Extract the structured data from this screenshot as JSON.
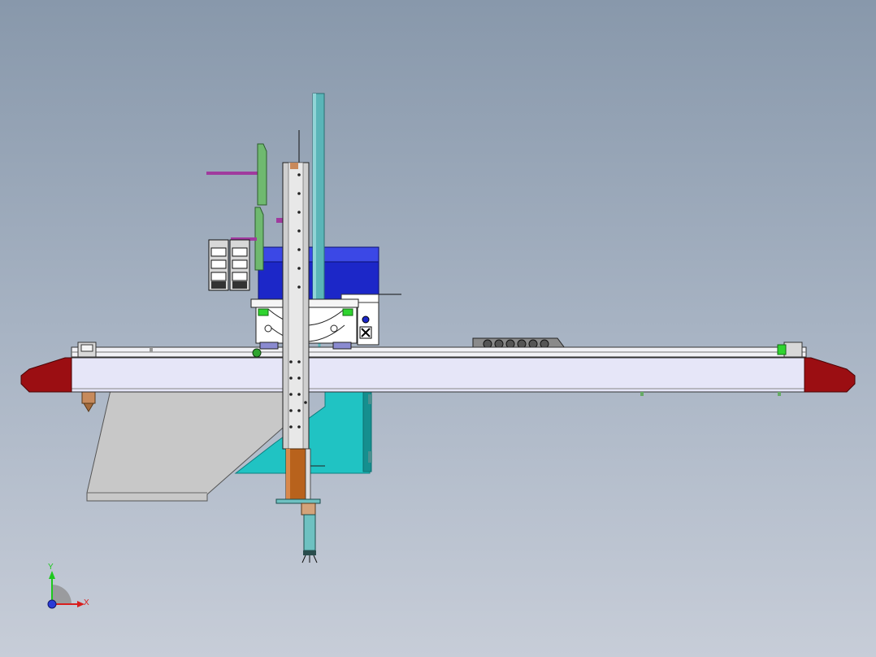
{
  "viewport": {
    "background_top": "#8898ab",
    "background_bottom": "#c7cdd8"
  },
  "model": {
    "colors": {
      "beam": "#e6e6f8",
      "end_cap": "#9b0e12",
      "motor_housing": "#1c27c8",
      "column": "#cfcfcf",
      "rod": "#5ab5b8",
      "plate_gray": "#c8c8c8",
      "plate_teal": "#20c3c3",
      "copper": "#b8621c",
      "bracket_green": "#6fb96f",
      "arm_magenta": "#a03a9e"
    }
  },
  "triad": {
    "x_label": "X",
    "y_label": "Y",
    "x_color": "#d81e1e",
    "y_color": "#1ec81e",
    "z_color": "#2a3ad8"
  }
}
